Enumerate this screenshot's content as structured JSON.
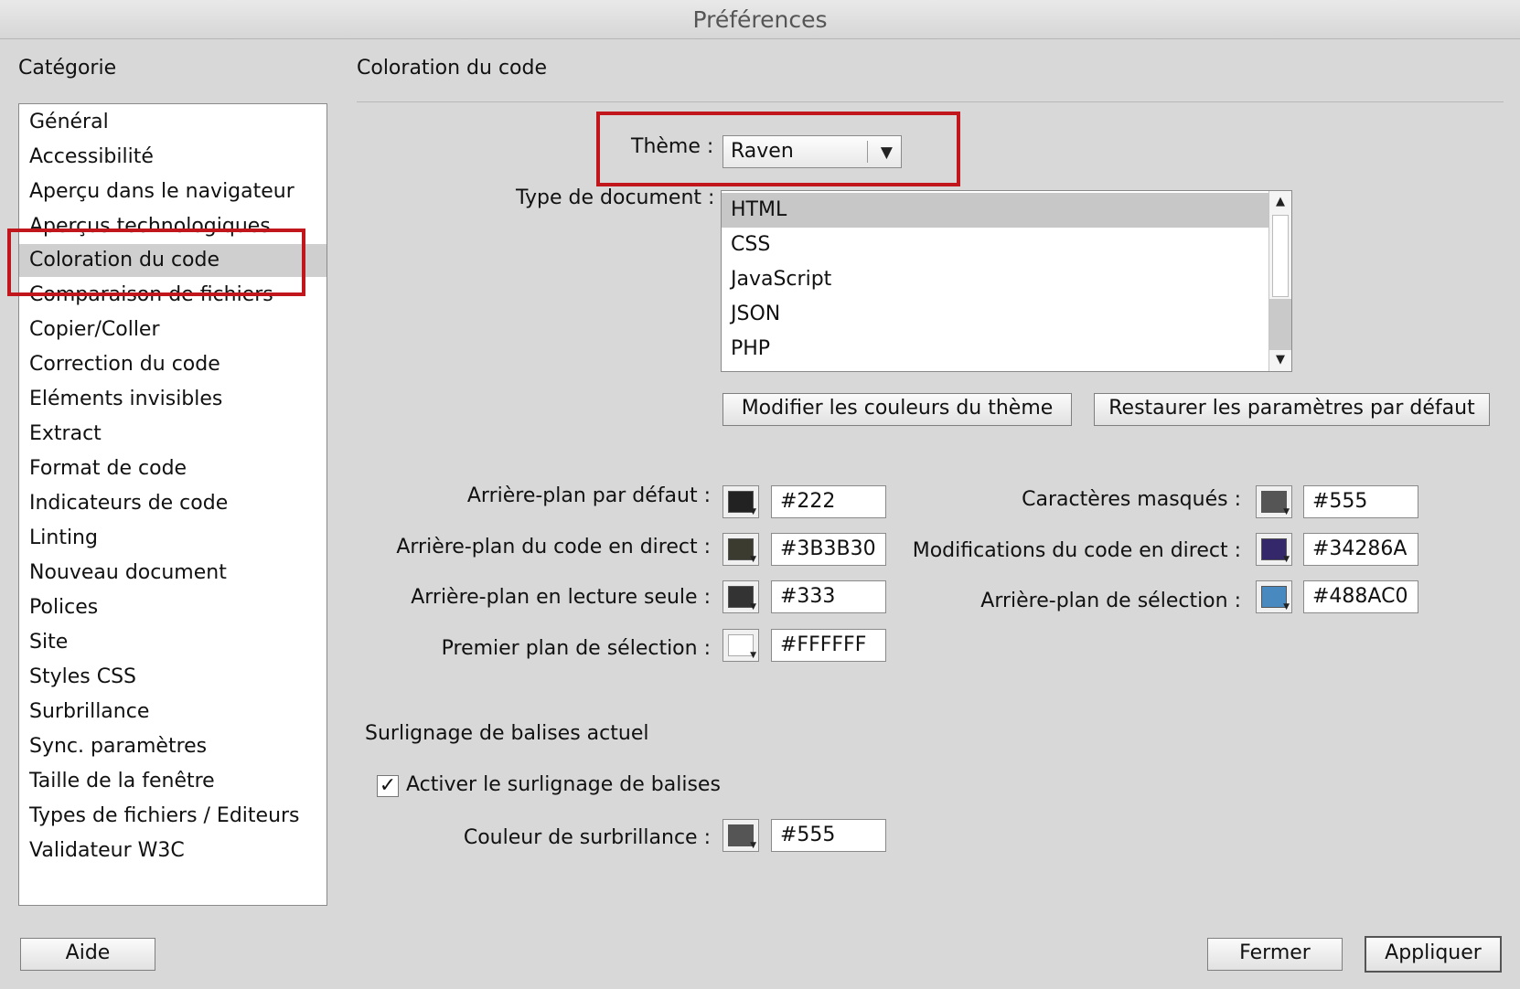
{
  "window": {
    "title": "Préférences"
  },
  "sidebar": {
    "heading": "Catégorie",
    "items": [
      {
        "label": "Général"
      },
      {
        "label": "Accessibilité"
      },
      {
        "label": "Aperçu dans le navigateur"
      },
      {
        "label": "Aperçus technologiques"
      },
      {
        "label": "Coloration du code",
        "selected": true
      },
      {
        "label": "Comparaison de fichiers"
      },
      {
        "label": "Copier/Coller"
      },
      {
        "label": "Correction du code"
      },
      {
        "label": "Eléments invisibles"
      },
      {
        "label": "Extract"
      },
      {
        "label": "Format de code"
      },
      {
        "label": "Indicateurs de code"
      },
      {
        "label": "Linting"
      },
      {
        "label": "Nouveau document"
      },
      {
        "label": "Polices"
      },
      {
        "label": "Site"
      },
      {
        "label": "Styles CSS"
      },
      {
        "label": "Surbrillance"
      },
      {
        "label": "Sync. paramètres"
      },
      {
        "label": "Taille de la fenêtre"
      },
      {
        "label": "Types de fichiers / Editeurs"
      },
      {
        "label": "Validateur W3C"
      }
    ]
  },
  "main": {
    "section_title": "Coloration du code",
    "theme": {
      "label": "Thème :",
      "value": "Raven"
    },
    "document_type": {
      "label": "Type de document :",
      "items": [
        "HTML",
        "CSS",
        "JavaScript",
        "JSON",
        "PHP"
      ],
      "selected": "HTML"
    },
    "buttons": {
      "edit_theme": "Modifier les couleurs du thème",
      "restore_defaults": "Restaurer les paramètres par défaut"
    },
    "colors_left": [
      {
        "label": "Arrière-plan par défaut :",
        "value": "#222",
        "color": "#222222"
      },
      {
        "label": "Arrière-plan du code en direct :",
        "value": "#3B3B30",
        "color": "#3B3B30"
      },
      {
        "label": "Arrière-plan en lecture seule :",
        "value": "#333",
        "color": "#333333"
      },
      {
        "label": "Premier plan de sélection :",
        "value": "#FFFFFF",
        "color": "#FFFFFF"
      }
    ],
    "colors_right": [
      {
        "label": "Caractères masqués :",
        "value": "#555",
        "color": "#555555"
      },
      {
        "label": "Modifications du code en direct :",
        "value": "#34286A",
        "color": "#34286A"
      },
      {
        "label": "Arrière-plan de sélection :",
        "value": "#488AC0",
        "color": "#488AC0"
      }
    ],
    "tag_highlight": {
      "heading": "Surlignage de balises actuel",
      "checkbox_label": "Activer le surlignage de balises",
      "checked": true,
      "color_label": "Couleur de surbrillance :",
      "color_value": "#555",
      "color": "#555555"
    }
  },
  "footer": {
    "help": "Aide",
    "close": "Fermer",
    "apply": "Appliquer"
  },
  "annotation_color": "#C0161C"
}
